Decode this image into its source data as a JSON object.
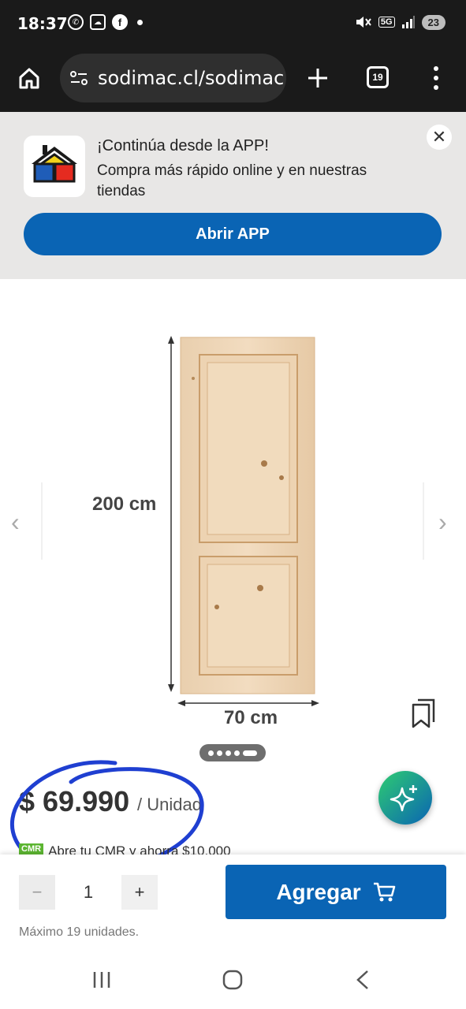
{
  "status_bar": {
    "time": "18:37",
    "network": "5G",
    "battery": "23",
    "icons": [
      "whatsapp-icon",
      "weather-icon",
      "facebook-icon",
      "mute-icon",
      "signal-icon"
    ]
  },
  "browser": {
    "url": "sodimac.cl/sodimac-",
    "tabs_count": "19",
    "icons": [
      "home-icon",
      "site-settings-icon",
      "new-tab-icon",
      "menu-icon"
    ]
  },
  "promo_banner": {
    "title": "¡Continúa desde la APP!",
    "subtitle": "Compra más rápido online y en nuestras tiendas",
    "cta": "Abrir APP",
    "close_label": "✕"
  },
  "product_image": {
    "height_label": "200 cm",
    "width_label": "70 cm",
    "pager_count": 5,
    "pager_active": 4
  },
  "price": {
    "amount": "$ 69.990",
    "unit": "/ Unidad",
    "cmr_badge": "CMR",
    "cmr_text": "Abre tu CMR y ahorra $10.000"
  },
  "purchase": {
    "minus": "−",
    "quantity": "1",
    "plus": "+",
    "add_label": "Agregar",
    "max_note": "Máximo 19 unidades."
  },
  "colors": {
    "brand_blue": "#0a64b4",
    "banner_bg": "#e8e7e6",
    "wood": "#ecd3b5",
    "annotation": "#1f3fd1"
  }
}
